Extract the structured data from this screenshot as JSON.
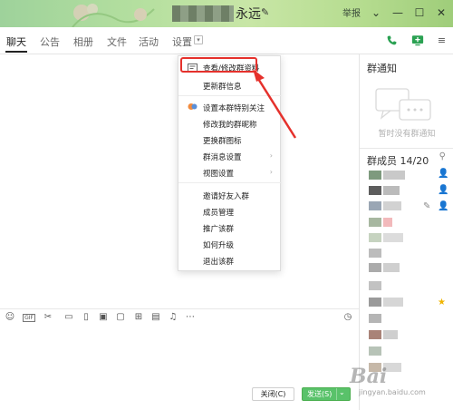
{
  "window": {
    "title": "永远",
    "report": "举报",
    "accent": "#2aa152",
    "titlebar_colors": [
      "#9ed29b",
      "#c8e6a6",
      "#9fcd7a"
    ]
  },
  "tabs": [
    {
      "label": "聊天",
      "active": true
    },
    {
      "label": "公告",
      "active": false
    },
    {
      "label": "相册",
      "active": false
    },
    {
      "label": "文件",
      "active": false
    },
    {
      "label": "活动",
      "active": false
    },
    {
      "label": "设置",
      "active": false
    }
  ],
  "menu": {
    "items": [
      {
        "label": "查看/修改群资料",
        "highlighted": true
      },
      {
        "label": "更新群信息"
      },
      {
        "label": "设置本群特别关注"
      },
      {
        "label": "修改我的群昵称"
      },
      {
        "label": "更换群图标"
      },
      {
        "label": "群消息设置",
        "submenu": true
      },
      {
        "label": "视图设置",
        "submenu": true
      },
      {
        "label": "邀请好友入群"
      },
      {
        "label": "成员管理"
      },
      {
        "label": "推广该群"
      },
      {
        "label": "如何升级"
      },
      {
        "label": "退出该群"
      }
    ],
    "highlight_color": "#e5312c"
  },
  "right_panel": {
    "notice_title": "群通知",
    "notice_empty": "暂时没有群通知",
    "members_title": "群成员 14/20"
  },
  "footer": {
    "close_label": "关闭(C)",
    "send_label": "发送(S)"
  },
  "watermark": {
    "text": "Bai",
    "sub": "jingyan.baidu.com"
  }
}
